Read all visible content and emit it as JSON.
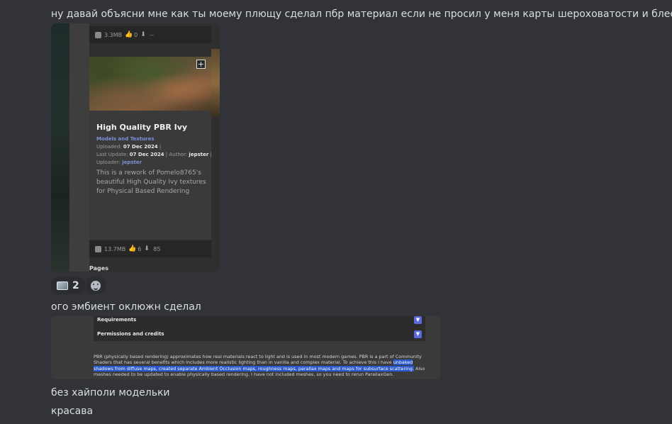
{
  "messages": {
    "msg1": "ну давай объясни мне как ты моему плющу сделал пбр материал если не просил у меня карты шероховатости и блеска",
    "msg2": "ого эмбиент оклюжн сделал",
    "msg3": "без хайполи модельки",
    "msg4": "красава"
  },
  "attachment1": {
    "top_stats": {
      "size": "3.3MB",
      "likes": "0",
      "extra": "--"
    },
    "card": {
      "title": "High Quality PBR Ivy",
      "category": "Models and Textures",
      "uploaded_label": "Uploaded:",
      "uploaded_date": "07 Dec 2024",
      "last_update_label": "Last Update:",
      "last_update_date": "07 Dec 2024",
      "author_label": "Author:",
      "author": "jepster",
      "uploader_label": "Uploader:",
      "uploader": "jepster",
      "description": "This is a rework of Pomelo8765's beautiful High Quality Ivy textures for Physical Based Rendering",
      "plus": "+"
    },
    "bottom_stats": {
      "size": "13.7MB",
      "likes": "6",
      "downloads": "85"
    },
    "pages_label": "Pages"
  },
  "reactions": {
    "count": "2",
    "emoji_icon": "image-emoji-icon",
    "add_icon": "add-reaction-icon"
  },
  "attachment2": {
    "row1": "Requirements",
    "row2": "Permissions and credits",
    "text_part1": "PBR (physically based rendering) approximates how real materials react to light and is used in most modern games. PBR is a part of Community Shaders that has several benefits which includes  more realistic lighting than in vanilla and complex material. To achieve this I have ",
    "text_highlight": "unbaked shadows from diffuse maps, created separate Ambient Occlusion maps, roughness maps, parallax maps and maps for subsurface scattering.",
    "text_part2": " Also meshes needed to be updated to enable physically based rendering. I have not included meshes, so you need to rerun ParallaxGen."
  }
}
